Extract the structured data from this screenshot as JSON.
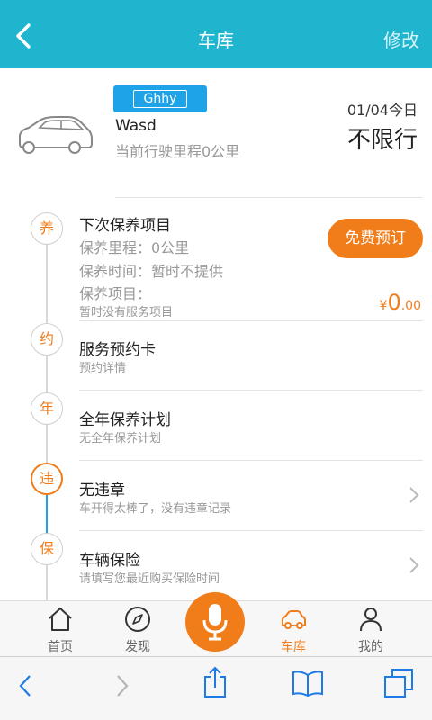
{
  "header": {
    "title": "车库",
    "edit_label": "修改"
  },
  "car": {
    "plate": "Ghhy",
    "name": "Wasd",
    "mileage_text": "当前行驶里程0公里",
    "date": "01/04今日",
    "restriction": "不限行"
  },
  "maintenance": {
    "node": "养",
    "title": "下次保养项目",
    "mileage": "保养里程：0公里",
    "time": "保养时间：暂时不提供",
    "items": "保养项目：",
    "note": "暂时没有服务项目",
    "book_button": "免费预订",
    "price_currency": "¥",
    "price_int": "0",
    "price_dec": ".00"
  },
  "appointment": {
    "node": "约",
    "title": "服务预约卡",
    "sub": "预约详情"
  },
  "yearly": {
    "node": "年",
    "title": "全年保养计划",
    "sub": "无全年保养计划"
  },
  "violation": {
    "node": "违",
    "title": "无违章",
    "sub": "车开得太棒了，没有违章记录"
  },
  "insurance": {
    "node": "保",
    "title": "车辆保险",
    "sub": "请填写您最近购买保险时间"
  },
  "tabbar": {
    "home": "首页",
    "discover": "发现",
    "garage": "车库",
    "mine": "我的"
  },
  "colors": {
    "header": "#1fb5cf",
    "accent": "#f07c1a",
    "plate": "#1fa3e8"
  }
}
